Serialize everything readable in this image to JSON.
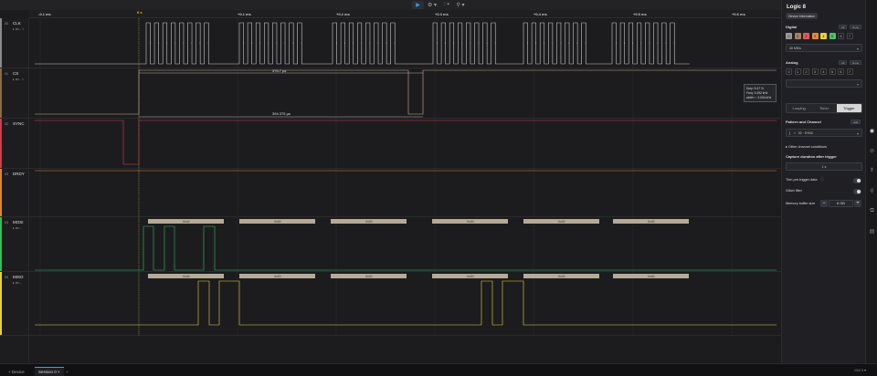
{
  "toolbar": {
    "play_icon": "▶",
    "gear_icon": "⚙ ▾",
    "trigger_icon": "⫶ ▾",
    "marker_icon": "⚲ ▾"
  },
  "ruler": {
    "ticks": [
      "-0.1 ms",
      "0 s",
      "+0.1 ms",
      "+0.2 ms",
      "+0.3 ms",
      "+0.4 ms",
      "+0.5 ms",
      "+0.6 ms"
    ],
    "trigger_label": "0 s"
  },
  "channels": [
    {
      "num": "00",
      "name": "CLK",
      "sub": "▸ an... ▿",
      "color": "#8a8a8a"
    },
    {
      "num": "01",
      "name": "CS",
      "sub": "▸ an... ▿",
      "color": "#8a6a4a"
    },
    {
      "num": "02",
      "name": "SYNC",
      "sub": "",
      "color": "#d23b4c"
    },
    {
      "num": "03",
      "name": "DRDY",
      "sub": "",
      "color": "#e0852b"
    },
    {
      "num": "04",
      "name": "MOSI",
      "sub": "▸ an...",
      "color": "#2fbf5a"
    },
    {
      "num": "05",
      "name": "MISO",
      "sub": "▸ an...",
      "color": "#e8d23a"
    }
  ],
  "measurements": {
    "cs_width": "376.7 µs",
    "cs_period": "394.375 µs"
  },
  "mosi_bytes": [
    "0x42",
    "0x00",
    "0x00",
    "0x00",
    "0x00",
    "0x00"
  ],
  "miso_bytes": [
    "0x04",
    "0x00",
    "0x00",
    "0x00",
    "0x00",
    "0x00"
  ],
  "tooltip": {
    "duty": "Duty: 5.47 %",
    "freq": "Freq: 3.492 kHz",
    "width": "width⁻¹: 3.004 kHz"
  },
  "panel": {
    "title": "Logic 8",
    "device_info": "Device Information",
    "digital_label": "Digital",
    "all_label": "All",
    "none_label": "None",
    "digital_channels": [
      "0",
      "1",
      "2",
      "3",
      "4",
      "5",
      "6",
      "7"
    ],
    "digital_colors": [
      "#9a9a9a",
      "#a88060",
      "#e05a5a",
      "#e08a3a",
      "#e8d23a",
      "#4cc46a",
      "#3b9be8",
      "#9a6ad6"
    ],
    "digital_rate": "40 MS/s",
    "analog_label": "Analog",
    "analog_channels": [
      "0",
      "1",
      "2",
      "3",
      "4",
      "5",
      "6",
      "7"
    ],
    "modes": [
      "Looping",
      "Timer",
      "Trigger"
    ],
    "pattern_label": "Pattern and Channel",
    "pattern_btn": "Add",
    "edge_symbol": "∫",
    "trigger_channel": "02 · SYNC",
    "other_conditions": "▸ Other channel conditions",
    "capture_label": "Capture duration after trigger",
    "capture_value": "1 s",
    "trim_label": "Trim pre-trigger data",
    "glitch_label": "Glitch filter",
    "memory_label": "Memory buffer size",
    "memory_value": "8 GB",
    "minus": "−",
    "plus": "+"
  },
  "bottom": {
    "device_tab": "+ Device",
    "session_tab": "Session 0 ×",
    "add_tab": "+",
    "right_text": "CM 3 ▾"
  }
}
